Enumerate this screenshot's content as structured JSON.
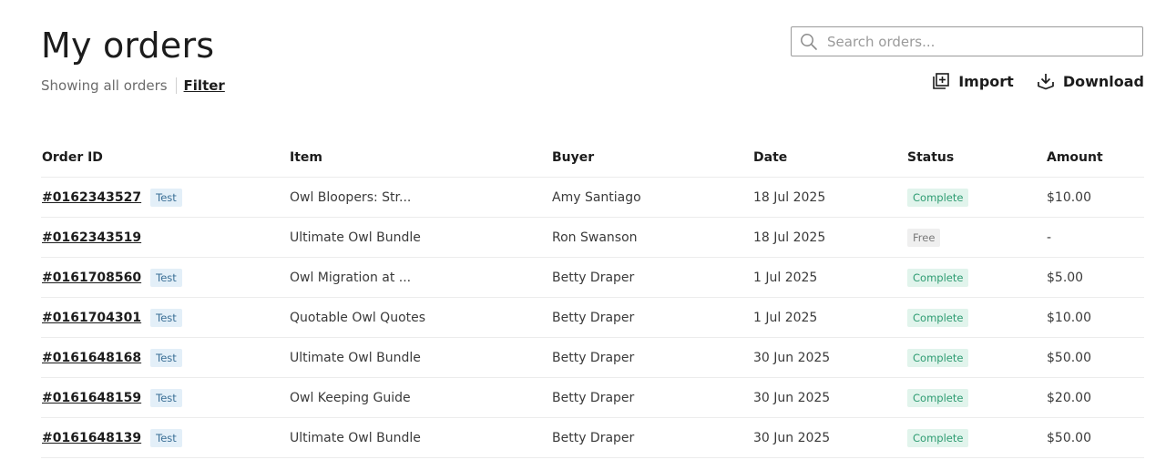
{
  "header": {
    "title": "My orders",
    "showing_text": "Showing all orders",
    "filter_label": "Filter"
  },
  "search": {
    "placeholder": "Search orders..."
  },
  "actions": {
    "import_label": "Import",
    "download_label": "Download"
  },
  "table": {
    "columns": [
      "Order ID",
      "Item",
      "Buyer",
      "Date",
      "Status",
      "Amount"
    ],
    "rows": [
      {
        "order_id": "#0162343527",
        "test": "Test",
        "item": "Owl Bloopers: Str...",
        "buyer": "Amy Santiago",
        "date": "18 Jul 2025",
        "status": "Complete",
        "status_type": "complete",
        "amount": "$10.00"
      },
      {
        "order_id": "#0162343519",
        "test": "",
        "item": "Ultimate Owl Bundle",
        "buyer": "Ron Swanson",
        "date": "18 Jul 2025",
        "status": "Free",
        "status_type": "free",
        "amount": "-"
      },
      {
        "order_id": "#0161708560",
        "test": "Test",
        "item": "Owl Migration at ...",
        "buyer": "Betty Draper",
        "date": "1 Jul 2025",
        "status": "Complete",
        "status_type": "complete",
        "amount": "$5.00"
      },
      {
        "order_id": "#0161704301",
        "test": "Test",
        "item": "Quotable Owl Quotes",
        "buyer": "Betty Draper",
        "date": "1 Jul 2025",
        "status": "Complete",
        "status_type": "complete",
        "amount": "$10.00"
      },
      {
        "order_id": "#0161648168",
        "test": "Test",
        "item": "Ultimate Owl Bundle",
        "buyer": "Betty Draper",
        "date": "30 Jun 2025",
        "status": "Complete",
        "status_type": "complete",
        "amount": "$50.00"
      },
      {
        "order_id": "#0161648159",
        "test": "Test",
        "item": "Owl Keeping Guide",
        "buyer": "Betty Draper",
        "date": "30 Jun 2025",
        "status": "Complete",
        "status_type": "complete",
        "amount": "$20.00"
      },
      {
        "order_id": "#0161648139",
        "test": "Test",
        "item": "Ultimate Owl Bundle",
        "buyer": "Betty Draper",
        "date": "30 Jun 2025",
        "status": "Complete",
        "status_type": "complete",
        "amount": "$50.00"
      }
    ]
  },
  "icons": {
    "search": "search-icon",
    "import": "import-icon",
    "download": "download-icon"
  },
  "colors": {
    "complete_bg": "#e1f4ec",
    "complete_text": "#2e9c72",
    "free_bg": "#efefef",
    "test_bg": "#e3eff8",
    "test_text": "#3a6f96"
  }
}
